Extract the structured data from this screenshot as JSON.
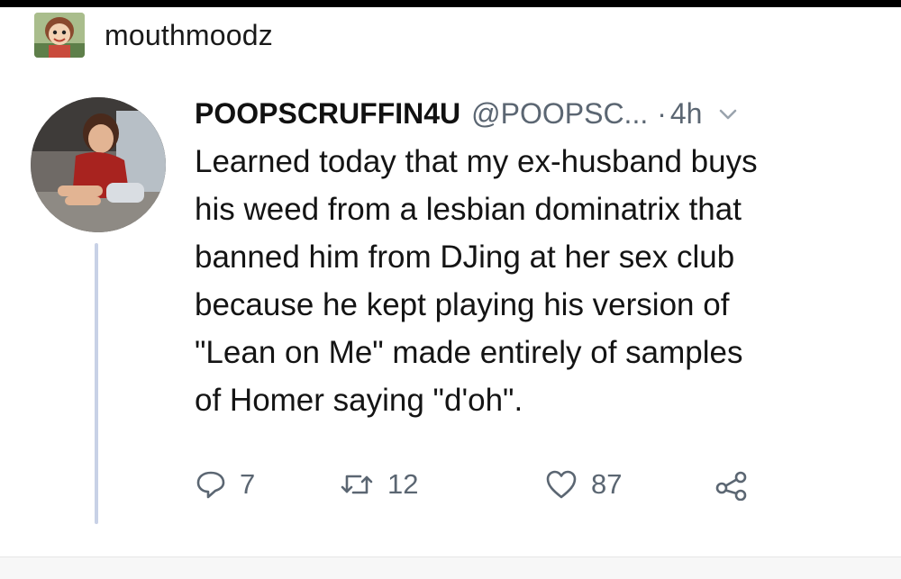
{
  "post": {
    "poster_name": "mouthmoodz",
    "poster_avatar_icon": "cartoon-face-avatar"
  },
  "tweet": {
    "display_name": "POOPSCRUFFIN4U",
    "handle": "@POOPSC...",
    "separator": "·",
    "time": "4h",
    "menu_icon": "chevron-down-icon",
    "avatar_icon": "child-photo-avatar",
    "text": "Learned today that my ex-husband buys\nhis weed from a lesbian dominatrix that\nbanned him from DJing at her sex club\nbecause he kept playing his version of\n\"Lean on Me\" made entirely of samples\nof Homer saying \"d'oh\".",
    "actions": {
      "reply_icon": "reply-bubble-icon",
      "reply_count": "7",
      "retweet_icon": "retweet-icon",
      "retweet_count": "12",
      "like_icon": "heart-icon",
      "like_count": "87",
      "share_icon": "share-icon"
    }
  },
  "colors": {
    "text": "#141414",
    "muted": "#5b6672",
    "thread_line": "#c8d1e6",
    "top_bar": "#000000"
  }
}
